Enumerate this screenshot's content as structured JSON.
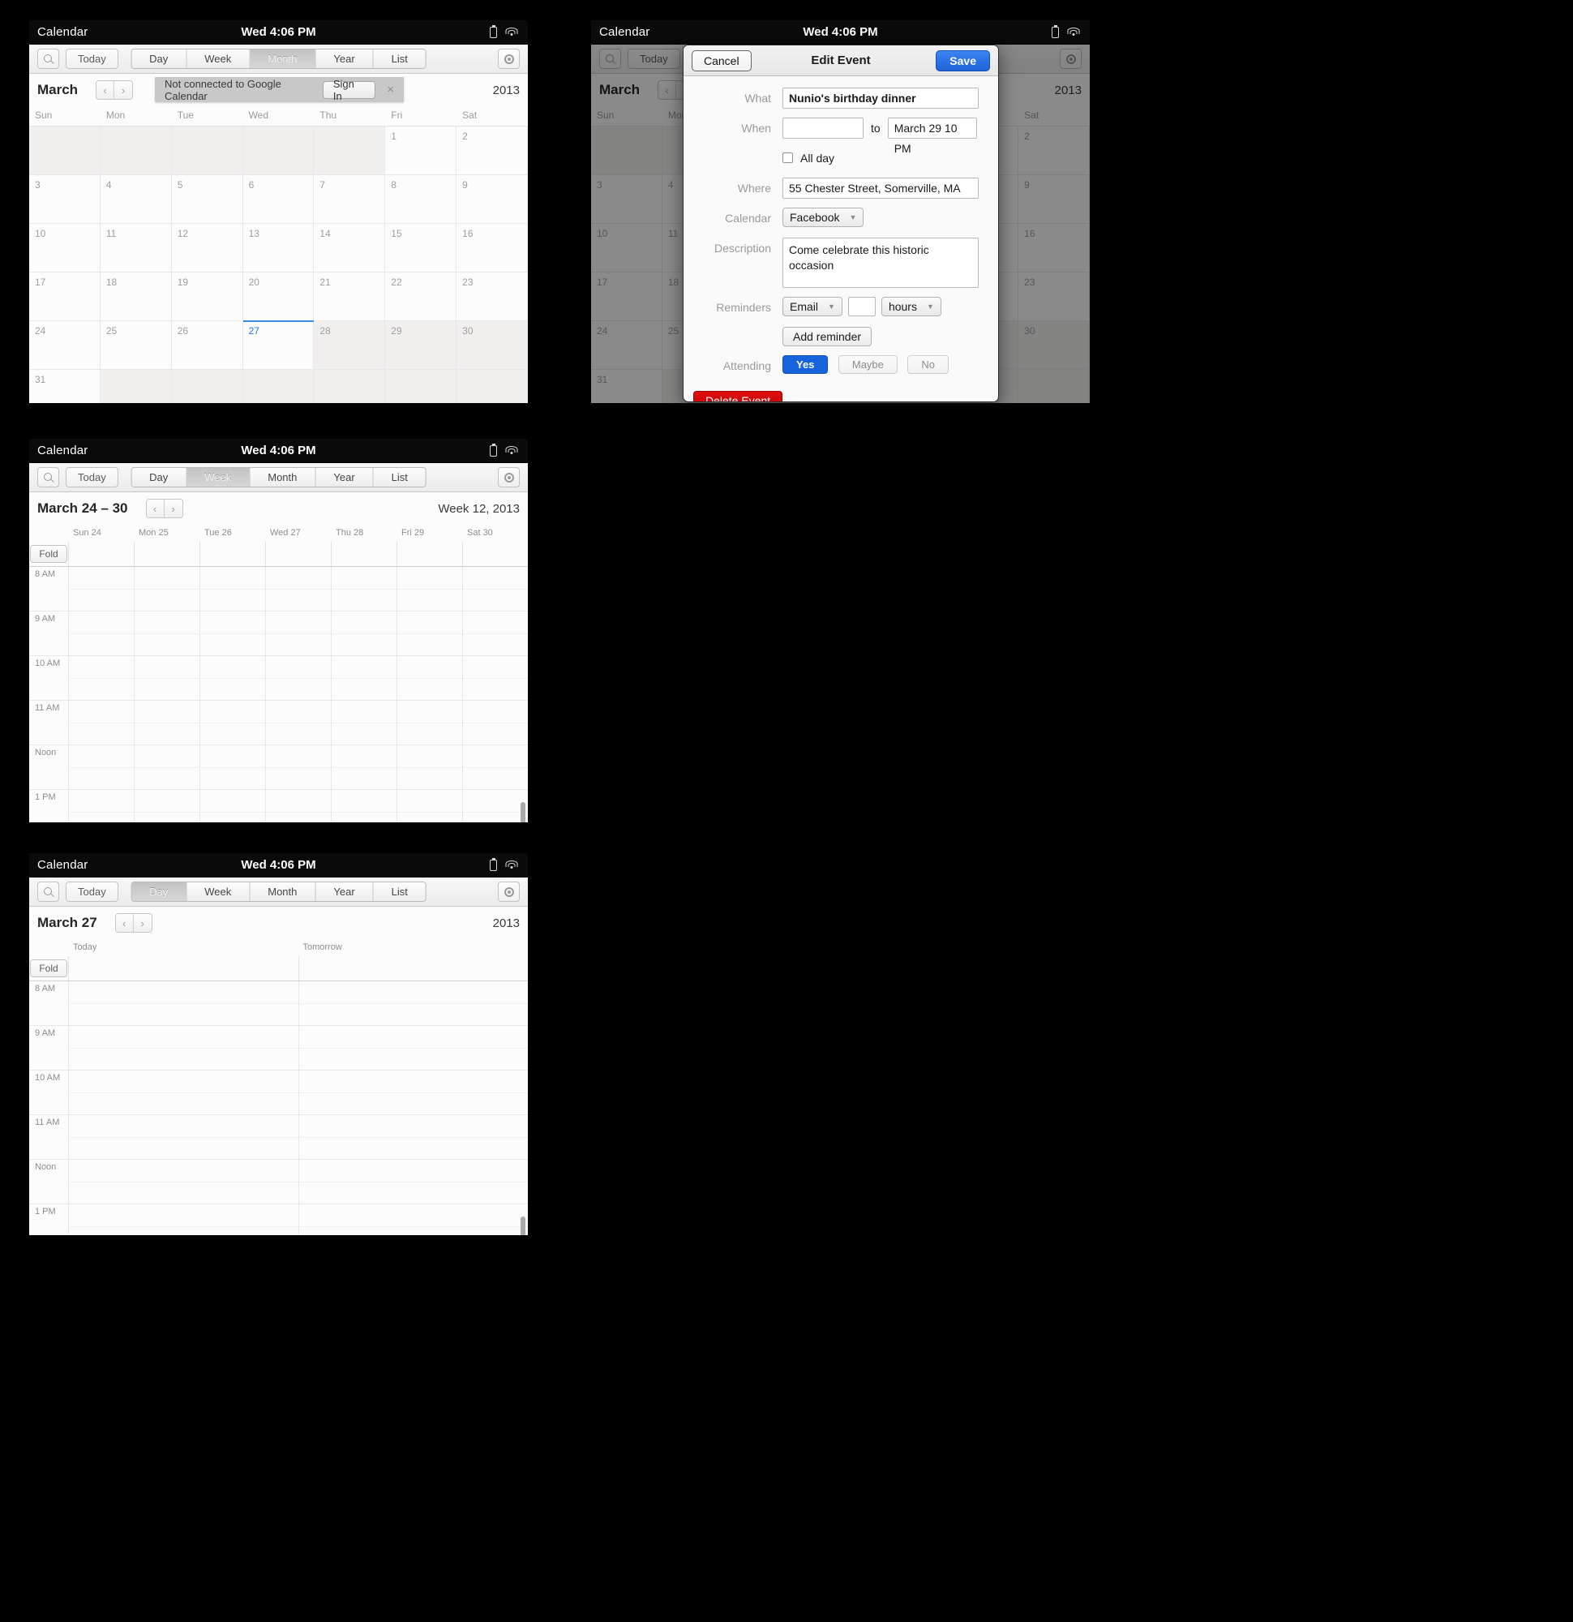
{
  "titlebar": {
    "app": "Calendar",
    "clock": "Wed 4:06 PM"
  },
  "toolbar": {
    "today": "Today",
    "views": [
      "Day",
      "Week",
      "Month",
      "Year",
      "List"
    ]
  },
  "month_panel": {
    "title": "March",
    "year": "2013",
    "prev": "‹",
    "next": "›",
    "banner": {
      "message": "Not connected to Google Calendar",
      "signin": "Sign In",
      "close": "×"
    },
    "weekdays": [
      "Sun",
      "Mon",
      "Tue",
      "Wed",
      "Thu",
      "Fri",
      "Sat"
    ],
    "active_view": "Month",
    "weeks": [
      [
        {
          "n": "",
          "dim": true
        },
        {
          "n": "",
          "dim": true
        },
        {
          "n": "",
          "dim": true
        },
        {
          "n": "",
          "dim": true
        },
        {
          "n": "",
          "dim": true
        },
        {
          "n": "1"
        },
        {
          "n": "2"
        }
      ],
      [
        {
          "n": "3"
        },
        {
          "n": "4"
        },
        {
          "n": "5"
        },
        {
          "n": "6"
        },
        {
          "n": "7"
        },
        {
          "n": "8"
        },
        {
          "n": "9"
        }
      ],
      [
        {
          "n": "10"
        },
        {
          "n": "11"
        },
        {
          "n": "12"
        },
        {
          "n": "13"
        },
        {
          "n": "14"
        },
        {
          "n": "15"
        },
        {
          "n": "16"
        }
      ],
      [
        {
          "n": "17"
        },
        {
          "n": "18"
        },
        {
          "n": "19"
        },
        {
          "n": "20"
        },
        {
          "n": "21"
        },
        {
          "n": "22"
        },
        {
          "n": "23"
        }
      ],
      [
        {
          "n": "24"
        },
        {
          "n": "25"
        },
        {
          "n": "26"
        },
        {
          "n": "27",
          "today": true
        },
        {
          "n": "28",
          "dim": true
        },
        {
          "n": "29",
          "dim": true
        },
        {
          "n": "30",
          "dim": true
        }
      ],
      [
        {
          "n": "31"
        },
        {
          "n": "",
          "dim": true
        },
        {
          "n": "",
          "dim": true
        },
        {
          "n": "",
          "dim": true
        },
        {
          "n": "",
          "dim": true
        },
        {
          "n": "",
          "dim": true
        },
        {
          "n": "",
          "dim": true
        }
      ]
    ]
  },
  "dialog": {
    "cancel": "Cancel",
    "title": "Edit Event",
    "save": "Save",
    "labels": {
      "what": "What",
      "when": "When",
      "to": "to",
      "allday": "All day",
      "where": "Where",
      "calendar": "Calendar",
      "description": "Description",
      "reminders": "Reminders",
      "attending": "Attending"
    },
    "values": {
      "what": "Nunio's birthday dinner",
      "when_start": "",
      "when_end": "March 29 10 PM",
      "where": "55 Chester Street, Somerville, MA",
      "calendar": "Facebook",
      "description": "Come celebrate this historic occasion",
      "reminder_type": "Email",
      "reminder_amount": "",
      "reminder_unit": "hours"
    },
    "add_reminder": "Add reminder",
    "attending_options": [
      {
        "label": "Yes",
        "selected": true
      },
      {
        "label": "Maybe",
        "selected": false
      },
      {
        "label": "No",
        "selected": false
      }
    ],
    "delete": "Delete Event"
  },
  "week_panel": {
    "title": "March 24 – 30",
    "week_label": "Week 12, 2013",
    "active_view": "Week",
    "fold": "Fold",
    "columns": [
      "Sun 24",
      "Mon 25",
      "Tue 26",
      "Wed 27",
      "Thu 28",
      "Fri 29",
      "Sat 30"
    ],
    "hours": [
      "8 AM",
      "9 AM",
      "10 AM",
      "11 AM",
      "Noon",
      "1 PM"
    ]
  },
  "day_panel": {
    "title": "March 27",
    "year": "2013",
    "active_view": "Day",
    "fold": "Fold",
    "columns": [
      "Today",
      "Tomorrow"
    ],
    "hours": [
      "8 AM",
      "9 AM",
      "10 AM",
      "11 AM",
      "Noon",
      "1 PM"
    ]
  },
  "colors": {
    "accent": "#1f7ae0",
    "save": "#1f62d8",
    "delete": "#c20000",
    "banner": "#c8c8c8"
  }
}
